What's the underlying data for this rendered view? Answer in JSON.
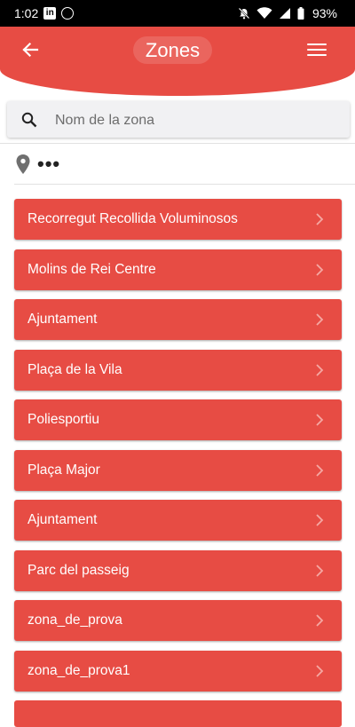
{
  "status_bar": {
    "time": "1:02",
    "battery": "93%",
    "icons": [
      "linkedin-icon",
      "whatsapp-icon",
      "mute-icon",
      "wifi-icon",
      "signal-icon",
      "battery-icon"
    ]
  },
  "header": {
    "title": "Zones",
    "back_icon": "arrow-left-icon",
    "menu_icon": "hamburger-menu-icon",
    "color": "#e74c44"
  },
  "search": {
    "placeholder": "Nom de la zona",
    "value": ""
  },
  "location": {
    "icon": "map-pin-icon",
    "text": "•••"
  },
  "zones": [
    {
      "label": "Recorregut Recollida Voluminosos"
    },
    {
      "label": "Molins de Rei Centre"
    },
    {
      "label": "Ajuntament"
    },
    {
      "label": "Plaça de la Vila"
    },
    {
      "label": "Poliesportiu"
    },
    {
      "label": "Plaça Major"
    },
    {
      "label": "Ajuntament"
    },
    {
      "label": "Parc del passeig"
    },
    {
      "label": "zona_de_prova"
    },
    {
      "label": "zona_de_prova1"
    }
  ]
}
